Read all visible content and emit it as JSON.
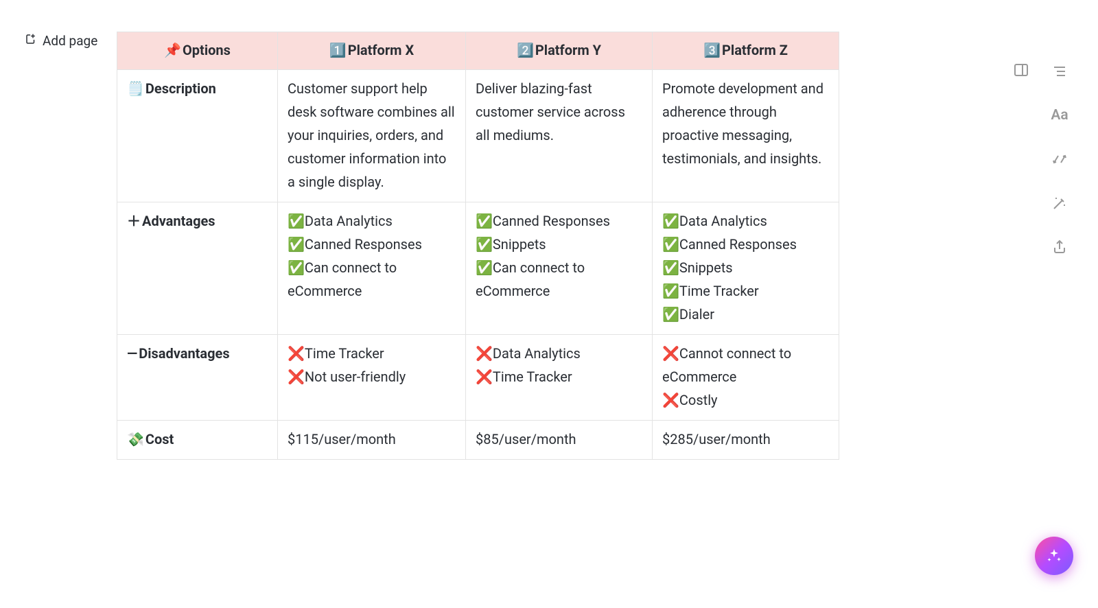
{
  "add_page_label": "Add page",
  "header": {
    "options_icon": "📌",
    "options_label": "Options",
    "col1_icon": "1️⃣",
    "col1_label": "Platform X",
    "col2_icon": "2️⃣",
    "col2_label": "Platform Y",
    "col3_icon": "3️⃣",
    "col3_label": "Platform Z"
  },
  "rows": {
    "description": {
      "icon": "🗒️",
      "label": "Description",
      "x": "Customer support help desk software combines all your in­quiries, orders, and customer information into a single display.",
      "y": "Deliver blazing-fast customer service across all mediums.",
      "z": "Promote develop­ment and adherence through proactive messaging, testimo­nials, and insights."
    },
    "advantages": {
      "icon": "＋",
      "label": "Advantages",
      "x": [
        "✅Data Analytics",
        "✅Canned Responses",
        "✅Can connect to eCommerce"
      ],
      "y": [
        "✅Canned Responses",
        "✅Snippets",
        "✅Can connect to eCommerce"
      ],
      "z": [
        "✅Data Analytics",
        "✅Canned Responses",
        "✅Snippets",
        "✅Time Tracker",
        "✅Dialer"
      ]
    },
    "disadvantages": {
      "icon": "—",
      "label": "Disadvantages",
      "x": [
        "❌Time Tracker",
        "❌Not user-friendly"
      ],
      "y": [
        "❌Data Analytics",
        "❌Time Tracker"
      ],
      "z": [
        "❌Cannot connect to eCommerce",
        "❌Costly"
      ]
    },
    "cost": {
      "icon": "💸",
      "label": "Cost",
      "x": "$115/user/month",
      "y": "$85/user/month",
      "z": "$285/user/month"
    }
  }
}
